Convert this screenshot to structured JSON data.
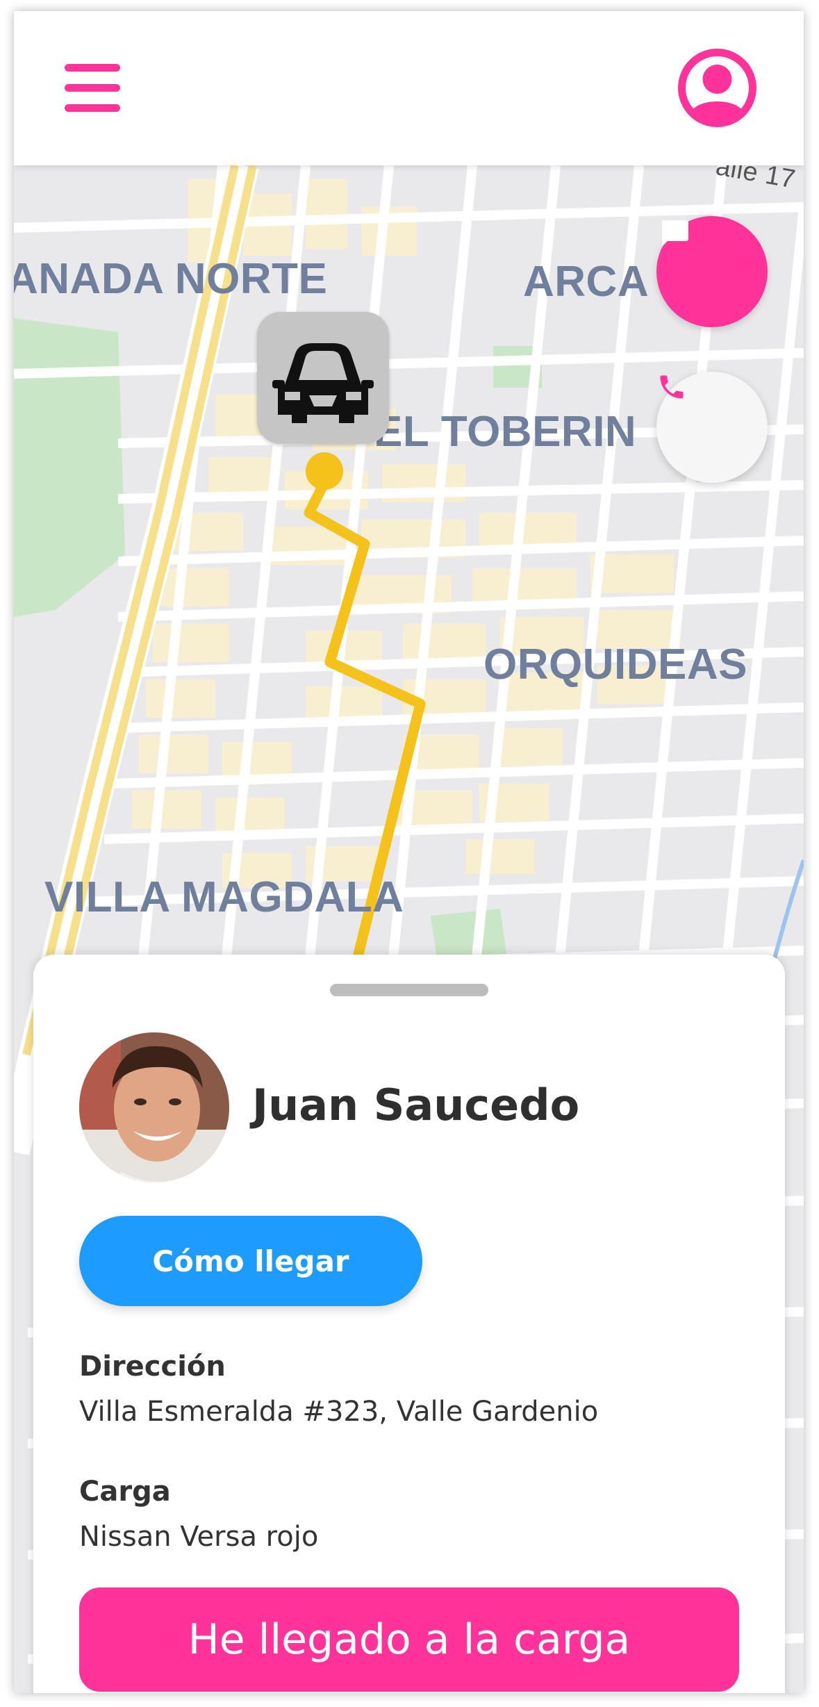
{
  "map": {
    "labels": {
      "granada_norte": "ANADA NORTE",
      "arca": "ARCA",
      "el_toberin": "EL TOBERIN",
      "orquideas": "ORQUIDEAS",
      "villa_magdala": "VILLA MAGDALA",
      "calle": "alle 17"
    },
    "route_color": "#f5c21b"
  },
  "driver": {
    "name": "Juan Saucedo"
  },
  "actions": {
    "directions_label": "Cómo llegar",
    "arrived_label": "He llegado a la carga"
  },
  "details": {
    "address_label": "Dirección",
    "address_value": "Villa Esmeralda #323, Valle Gardenio",
    "cargo_label": "Carga",
    "cargo_value": "Nissan Versa rojo"
  },
  "colors": {
    "accent": "#ff3399",
    "primary_button": "#1d9bff"
  },
  "icons": {
    "menu": "hamburger-menu-icon",
    "profile": "user-profile-icon",
    "chat": "chat-bubble-icon",
    "call": "phone-icon",
    "car": "car-icon"
  }
}
